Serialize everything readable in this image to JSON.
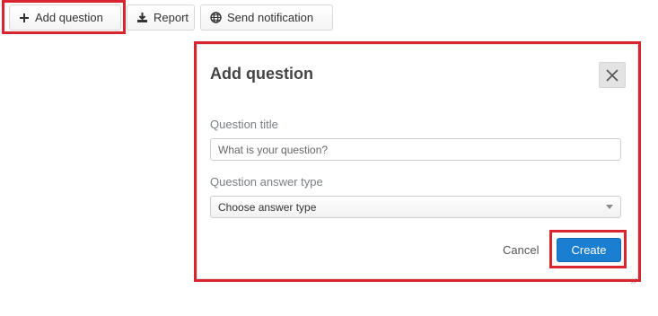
{
  "toolbar": {
    "add_question_label": "Add question",
    "report_label": "Report",
    "send_notification_label": "Send notification"
  },
  "modal": {
    "title": "Add question",
    "question_title_label": "Question title",
    "question_title_placeholder": "What is your question?",
    "question_title_value": "",
    "answer_type_label": "Question answer type",
    "answer_type_selected": "Choose answer type",
    "cancel_label": "Cancel",
    "create_label": "Create"
  },
  "colors": {
    "highlight": "#d9252f",
    "primary_button": "#1b7fd1"
  },
  "icons": {
    "add": "plus-icon",
    "report": "download-icon",
    "notify": "globe-icon",
    "close": "close-icon",
    "select": "chevron-down-icon"
  }
}
